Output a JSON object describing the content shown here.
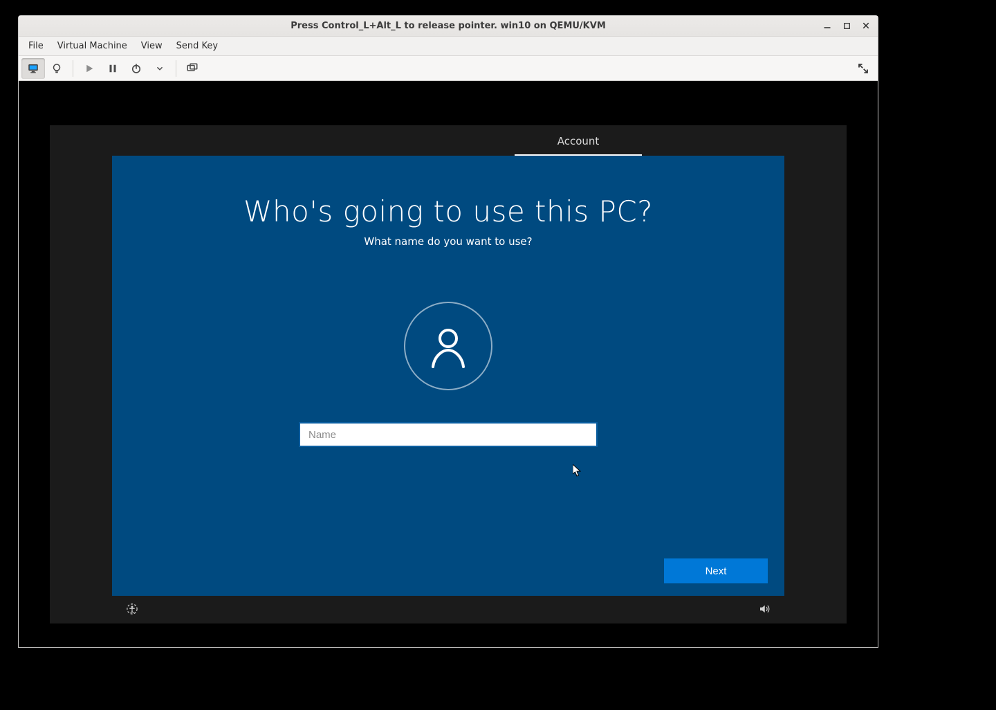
{
  "window": {
    "title": "Press Control_L+Alt_L to release pointer. win10 on QEMU/KVM"
  },
  "menu": {
    "file": "File",
    "vm": "Virtual Machine",
    "view": "View",
    "send_key": "Send Key"
  },
  "oobe": {
    "tab_label": "Account",
    "heading": "Who's going to use this PC?",
    "subheading": "What name do you want to use?",
    "name_placeholder": "Name",
    "name_value": "",
    "next_label": "Next"
  }
}
